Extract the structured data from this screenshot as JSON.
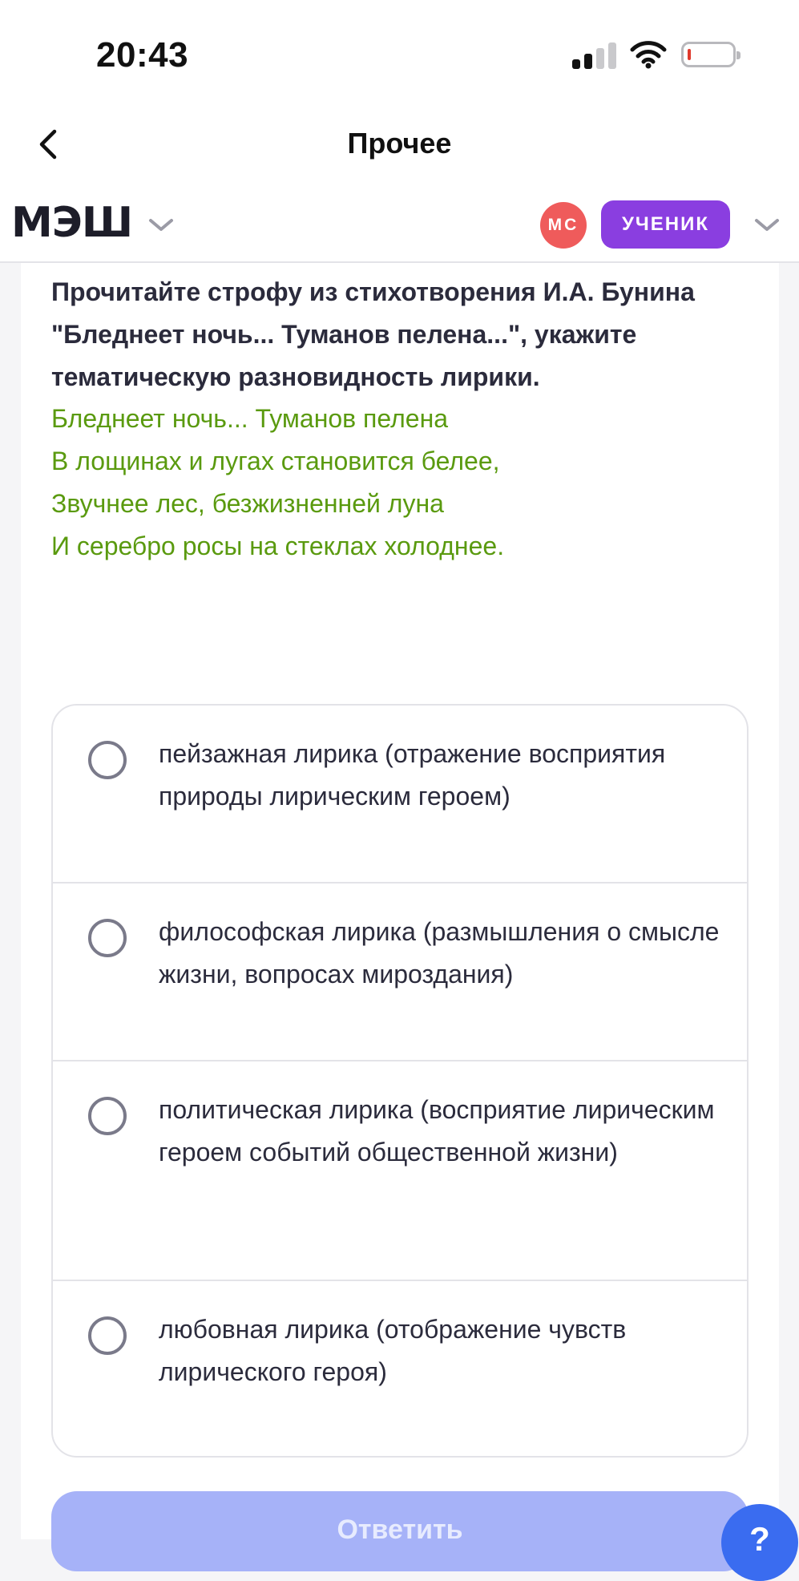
{
  "status_bar": {
    "time": "20:43",
    "battery_color": "#e0392b"
  },
  "nav": {
    "title": "Прочее",
    "back_icon": "chevron-left-icon"
  },
  "header": {
    "logo": "МЭШ",
    "avatar_initials": "МС",
    "avatar_color": "#ef5b5b",
    "role_label": "УЧЕНИК",
    "role_color": "#8a3ee0"
  },
  "task": {
    "question": "Прочитайте строфу из стихотворения И.А. Бунина \"Бледнеет ночь... Туманов пелена...\", укажите тематическую разновидность лирики.",
    "poem_lines": [
      "Бледнеет ночь... Туманов пелена",
      "В лощинах и лугах становится белее,",
      "Звучнее лес, безжизненней луна",
      "И серебро росы на стеклах холоднее."
    ],
    "poem_color": "#5a9a0f",
    "options": [
      "пейзажная лирика (отражение восприятия природы лирическим героем)",
      "философская лирика (размышления о смысле жизни, вопросах мироздания)",
      "политическая лирика (восприятие лирическим героем событий общественной жизни)",
      "любовная лирика (отображение чувств лирического героя)"
    ],
    "submit_label": "Ответить",
    "submit_color": "#a6b2f8",
    "help_label": "?"
  }
}
